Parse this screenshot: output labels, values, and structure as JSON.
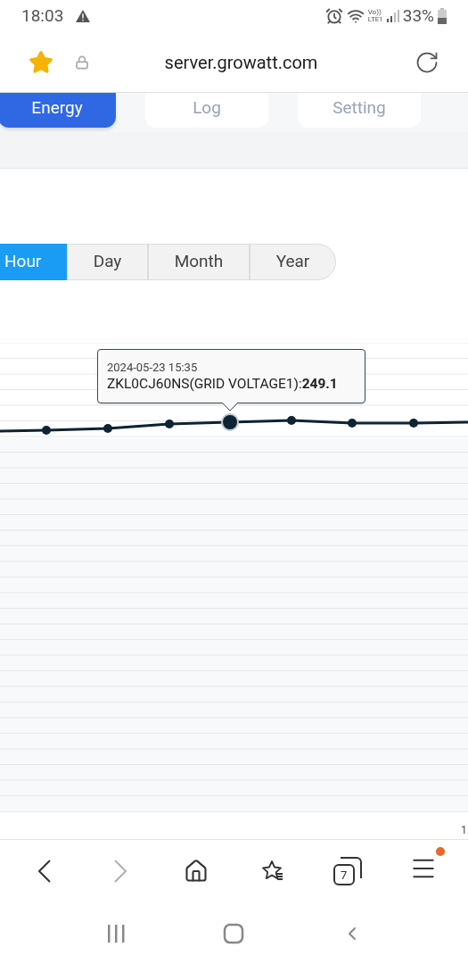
{
  "status_bar": {
    "time": "18:03",
    "network": [
      "Vo))",
      "LTE1"
    ],
    "battery": "33%"
  },
  "address_bar": {
    "url": "server.growatt.com",
    "bookmarked": true
  },
  "tabs": [
    {
      "label": "Energy",
      "selected": true
    },
    {
      "label": "Log",
      "selected": false
    },
    {
      "label": "Setting",
      "selected": false
    }
  ],
  "period_tabs": [
    {
      "label": "Hour",
      "selected": true
    },
    {
      "label": "Day",
      "selected": false
    },
    {
      "label": "Month",
      "selected": false
    },
    {
      "label": "Year",
      "selected": false
    }
  ],
  "tooltip": {
    "time": "2024-05-23 15:35",
    "series": "ZKL0CJ60NS(GRID VOLTAGE1):",
    "value": "249.1"
  },
  "x_axis_label": "1",
  "nav_buttons": [
    {
      "kind": "back",
      "disabled": false
    },
    {
      "kind": "forward",
      "disabled": true
    },
    {
      "kind": "home"
    },
    {
      "kind": "bookmarks"
    },
    {
      "kind": "tabs",
      "count": "7"
    },
    {
      "kind": "menu",
      "notification": true
    }
  ]
}
